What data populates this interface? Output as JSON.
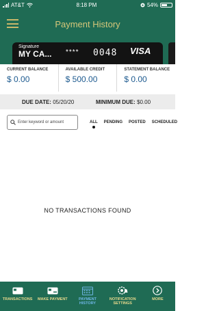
{
  "status_bar": {
    "carrier": "AT&T",
    "time": "8:18 PM",
    "battery": "54%",
    "battery_level": 0.54
  },
  "header": {
    "title": "Payment History"
  },
  "card": {
    "label_top": "Signature",
    "name": "MY CA...",
    "mask": "****",
    "last4": "0048",
    "brand": "VISA"
  },
  "balances": [
    {
      "label": "CURRENT BALANCE",
      "value": "$ 0.00"
    },
    {
      "label": "AVAILABLE CREDIT",
      "value": "$ 500.00"
    },
    {
      "label": "STATEMENT BALANCE",
      "value": "$ 0.00"
    }
  ],
  "due": {
    "date_label": "DUE DATE:",
    "date_value": "05/20/20",
    "min_label": "MINIMUM DUE:",
    "min_value": "$0.00"
  },
  "search": {
    "placeholder": "Enter keyword or amount"
  },
  "filters": [
    "ALL",
    "PENDING",
    "POSTED",
    "SCHEDULED"
  ],
  "active_filter": "ALL",
  "empty_message": "NO TRANSACTIONS FOUND",
  "bottom_nav": [
    {
      "label": "TRANSACTIONS",
      "icon": "card-icon"
    },
    {
      "label": "MAKE PAYMENT",
      "icon": "payment-icon"
    },
    {
      "label": "PAYMENT HISTORY",
      "icon": "calendar-icon",
      "active": true
    },
    {
      "label": "NOTIFICATION SETTINGS",
      "icon": "gear-bell-icon"
    },
    {
      "label": "MORE",
      "icon": "chevron-right-circle-icon"
    }
  ],
  "colors": {
    "brand_green": "#1f6b54",
    "gold": "#d6c77a",
    "value_blue": "#1d5a8f",
    "active_blue": "#6fb6e6"
  }
}
